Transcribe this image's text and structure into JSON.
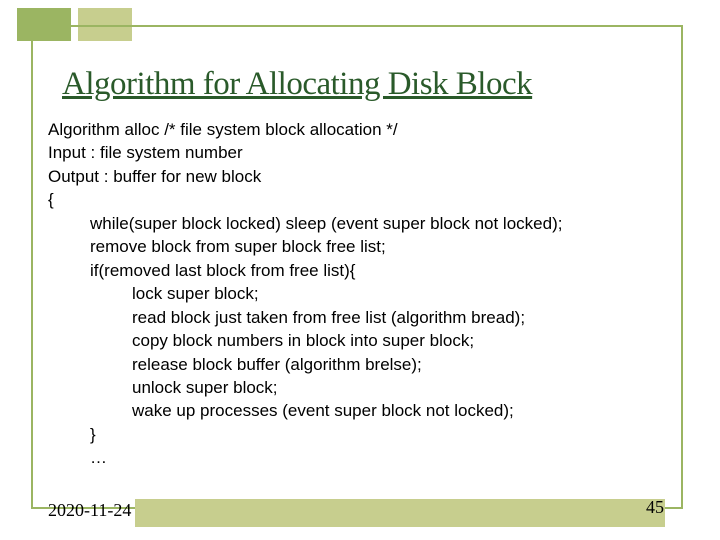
{
  "title": "Algorithm for Allocating Disk Block",
  "lines": [
    {
      "t": "Algorithm alloc    /* file system block allocation */",
      "i": 0
    },
    {
      "t": "Input : file system number",
      "i": 0
    },
    {
      "t": "Output : buffer for new block",
      "i": 0
    },
    {
      "t": "{",
      "i": 0
    },
    {
      "t": "while(super block locked) sleep (event super block not locked);",
      "i": 1
    },
    {
      "t": "remove block from super block free list;",
      "i": 1
    },
    {
      "t": "if(removed last block from free list){",
      "i": 1
    },
    {
      "t": "lock super block;",
      "i": 2
    },
    {
      "t": "read block just taken from free list (algorithm bread);",
      "i": 2
    },
    {
      "t": "copy block numbers in block into super block;",
      "i": 2
    },
    {
      "t": "release block buffer (algorithm brelse);",
      "i": 2
    },
    {
      "t": "unlock super block;",
      "i": 2
    },
    {
      "t": "wake up processes (event super block not locked);",
      "i": 2
    },
    {
      "t": "}",
      "i": 1
    },
    {
      "t": "…",
      "i": 1
    }
  ],
  "footer": {
    "date": "2020-11-24",
    "page": "45"
  }
}
